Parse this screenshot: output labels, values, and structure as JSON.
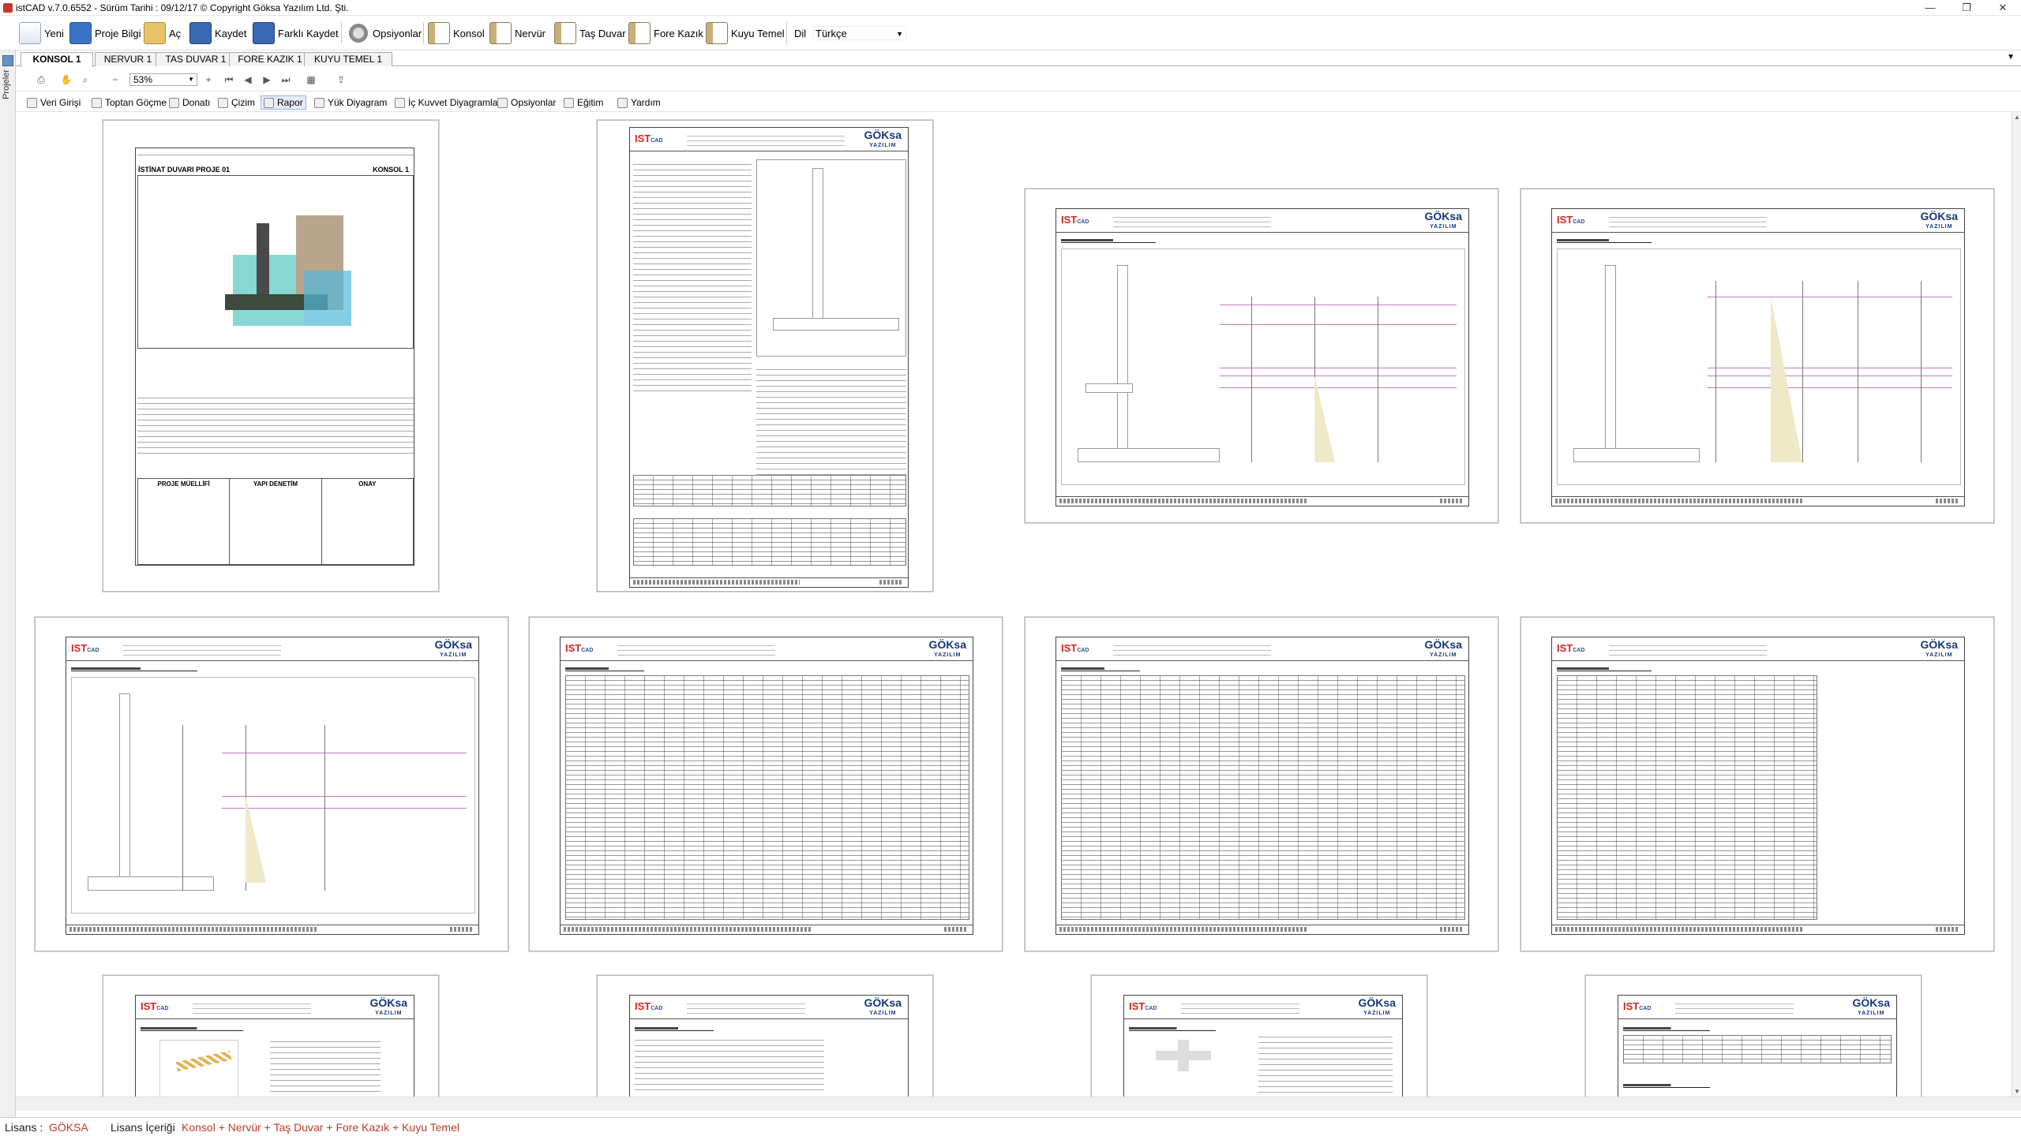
{
  "window": {
    "title": "istCAD v.7.0.6552 -  Sürüm Tarihi : 09/12/17  © Copyright Göksa Yazılım Ltd. Şti.",
    "minimize": "—",
    "maximize": "❐",
    "close": "✕"
  },
  "toolbar": {
    "new": "Yeni",
    "project_info": "Proje Bilgi",
    "open": "Aç",
    "save": "Kaydet",
    "save_as": "Farklı Kaydet",
    "options": "Opsiyonlar",
    "konsol": "Konsol",
    "nervur": "Nervür",
    "tas_duvar": "Taş Duvar",
    "fore_kazik": "Fore Kazık",
    "kuyu_temel": "Kuyu Temel",
    "lang_label": "Dil",
    "lang_value": "Türkçe"
  },
  "sidebar": {
    "label": "Projeler"
  },
  "tabs": [
    {
      "label": "KONSOL 1",
      "active": true
    },
    {
      "label": "NERVUR 1",
      "active": false
    },
    {
      "label": "TAS DUVAR 1",
      "active": false
    },
    {
      "label": "FORE KAZIK 1",
      "active": false
    },
    {
      "label": "KUYU TEMEL 1",
      "active": false
    }
  ],
  "viewbar": {
    "zoom": "53%"
  },
  "menubar": {
    "veri_girisi": "Veri Girişi",
    "toptan_gocme": "Toptan Göçme",
    "donati": "Donatı",
    "cizim": "Çizim",
    "rapor": "Rapor",
    "yuk_diyagram": "Yük Diyagram",
    "ic_kuvvet": "İç Kuvvet Diyagramları",
    "opsiyonlar": "Opsiyonlar",
    "egitim": "Eğitim",
    "yardim": "Yardım"
  },
  "cover": {
    "project_title": "İSTİNAT DUVARI PROJE 01",
    "element": "KONSOL 1",
    "col1": "PROJE MÜELLİFİ",
    "col2": "YAPI DENETİM",
    "col3": "ONAY"
  },
  "report": {
    "logo_left": "IST",
    "logo_left_sub": "CAD",
    "logo_right": "GÖKsa",
    "logo_right_sub": "YAZILIM"
  },
  "status": {
    "license_label": "Lisans :",
    "license_value": "GÖKSA",
    "content_label": "Lisans İçeriği",
    "content_value": "Konsol + Nervür + Taş Duvar + Fore Kazık + Kuyu Temel"
  },
  "colors": {
    "accent_red": "#c0392b",
    "brand_blue": "#16387a"
  }
}
